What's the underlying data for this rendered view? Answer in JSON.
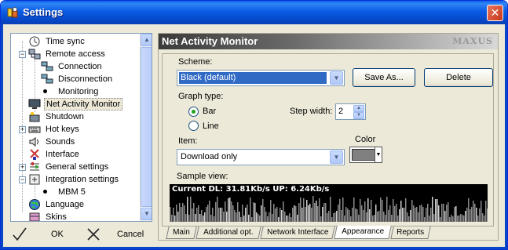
{
  "window": {
    "title": "Settings",
    "close_symbol": "✕"
  },
  "tree": {
    "items": [
      {
        "label": "Time sync",
        "icon": "clock-icon"
      },
      {
        "label": "Remote access",
        "icon": "network-icon",
        "expander": "−"
      },
      {
        "label": "Connection",
        "icon": "computers-icon"
      },
      {
        "label": "Disconnection",
        "icon": "computers-icon"
      },
      {
        "label": "Monitoring",
        "icon": "bullet"
      },
      {
        "label": "Net Activity Monitor",
        "icon": "monitor-icon"
      },
      {
        "label": "Shutdown",
        "icon": "shutdown-icon"
      },
      {
        "label": "Hot keys",
        "icon": "keyboard-icon",
        "expander": "+"
      },
      {
        "label": "Sounds",
        "icon": "speaker-icon"
      },
      {
        "label": "Interface",
        "icon": "interface-icon"
      },
      {
        "label": "General settings",
        "icon": "settings-icon",
        "expander": "+"
      },
      {
        "label": "Integration settings",
        "icon": "integration-icon",
        "expander": "−"
      },
      {
        "label": "MBM 5",
        "icon": "bullet"
      },
      {
        "label": "Language",
        "icon": "globe-icon"
      },
      {
        "label": "Skins",
        "icon": "skins-icon"
      }
    ]
  },
  "footer": {
    "ok_label": "OK",
    "cancel_label": "Cancel"
  },
  "panel": {
    "title": "Net Activity Monitor",
    "brand": "MAXUS",
    "scheme_label": "Scheme:",
    "scheme_value": "Black (default)",
    "save_as_label": "Save As...",
    "delete_label": "Delete",
    "graph_type_label": "Graph type:",
    "bar_label": "Bar",
    "line_label": "Line",
    "selected_graph": "Bar",
    "step_width_label": "Step width:",
    "step_width_value": "2",
    "item_label": "Item:",
    "item_value": "Download only",
    "color_label": "Color",
    "color_value": "#808080",
    "sample_label": "Sample view:",
    "sample_text": "Current DL: 31.81Kb/s  UP: 6.24Kb/s"
  },
  "tabs": [
    {
      "label": "Main"
    },
    {
      "label": "Additional opt."
    },
    {
      "label": "Network Interface"
    },
    {
      "label": "Appearance",
      "active": true
    },
    {
      "label": "Reports"
    }
  ]
}
